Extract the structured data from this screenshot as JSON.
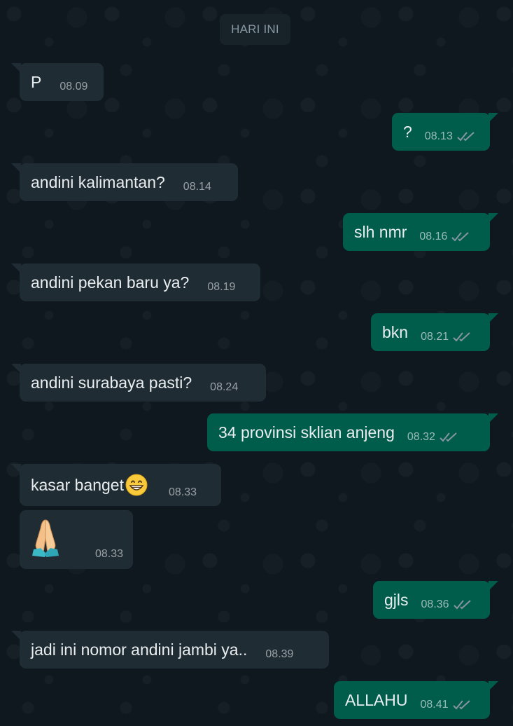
{
  "date_chip": "HARI INI",
  "messages": [
    {
      "text": "P",
      "time": "08.09",
      "direction": "in"
    },
    {
      "text": "?",
      "time": "08.13",
      "direction": "out"
    },
    {
      "text": "andini kalimantan?",
      "time": "08.14",
      "direction": "in"
    },
    {
      "text": "slh nmr",
      "time": "08.16",
      "direction": "out"
    },
    {
      "text": "andini pekan baru ya?",
      "time": "08.19",
      "direction": "in"
    },
    {
      "text": "bkn",
      "time": "08.21",
      "direction": "out"
    },
    {
      "text": "andini surabaya pasti?",
      "time": "08.24",
      "direction": "in"
    },
    {
      "text": "34 provinsi sklian anjeng",
      "time": "08.32",
      "direction": "out"
    },
    {
      "text": "kasar banget",
      "emoji": "grinning-face-emoji",
      "time": "08.33",
      "direction": "in"
    },
    {
      "text": "",
      "emoji": "folded-hands-emoji",
      "time": "08.33",
      "direction": "in"
    },
    {
      "text": "gjls",
      "time": "08.36",
      "direction": "out"
    },
    {
      "text": "jadi ini nomor andini jambi ya..",
      "time": "08.39",
      "direction": "in"
    },
    {
      "text": "ALLAHU",
      "time": "08.41",
      "direction": "out"
    }
  ],
  "colors": {
    "background": "#0b141a",
    "incoming_bubble": "#1f2c34",
    "outgoing_bubble": "#005c4b",
    "text": "#e9edef",
    "ticks": "#8696a0"
  }
}
